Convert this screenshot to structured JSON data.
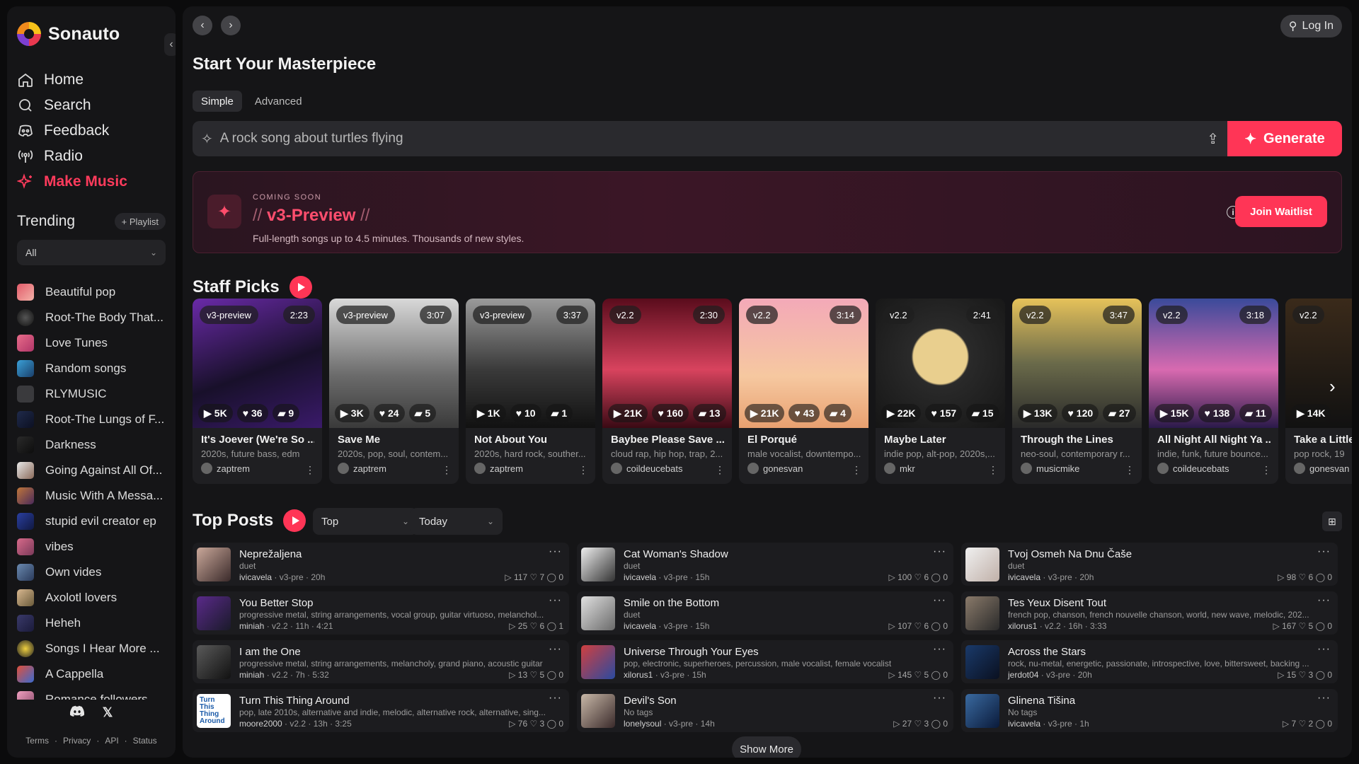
{
  "brand": {
    "name": "Sonauto"
  },
  "nav": [
    {
      "label": "Home",
      "icon": "home-icon"
    },
    {
      "label": "Search",
      "icon": "search-icon"
    },
    {
      "label": "Feedback",
      "icon": "discord-icon"
    },
    {
      "label": "Radio",
      "icon": "radio-icon"
    },
    {
      "label": "Make Music",
      "icon": "sparkle-icon",
      "active": true
    }
  ],
  "trending": {
    "title": "Trending",
    "playlist_button": "+ Playlist",
    "filter": "All",
    "items": [
      "Beautiful pop",
      "Root-The Body That...",
      "Love Tunes",
      "Random songs",
      "RLYMUSIC",
      "Root-The Lungs of F...",
      "Darkness",
      "Going Against All Of...",
      "Music With A Messa...",
      "stupid evil creator ep",
      "vibes",
      "Own vides",
      "Axolotl lovers",
      "Heheh",
      "Songs I Hear More ...",
      "A Cappella",
      "Romance followers"
    ]
  },
  "footer": {
    "links": [
      "Terms",
      "·",
      "Privacy",
      "·",
      "API",
      "·",
      "Status"
    ]
  },
  "header": {
    "login": "Log In"
  },
  "create": {
    "title": "Start Your Masterpiece",
    "tabs": [
      "Simple",
      "Advanced"
    ],
    "selected_tab": "Simple",
    "prompt_placeholder": "A rock song about turtles flying",
    "generate": "Generate"
  },
  "banner": {
    "eyebrow": "COMING SOON",
    "slash_left": "//",
    "title": "v3-Preview",
    "slash_right": "//",
    "description": "Full-length songs up to 4.5 minutes. Thousands of new styles.",
    "button": "Join Waitlist"
  },
  "staff_picks": {
    "title": "Staff Picks",
    "cards": [
      {
        "version": "v3-preview",
        "duration": "2:23",
        "plays": "5K",
        "likes": "36",
        "comments": "9",
        "title": "It's Joever (We're So ...",
        "tags": "2020s, future bass, edm",
        "user": "zaptrem"
      },
      {
        "version": "v3-preview",
        "duration": "3:07",
        "plays": "3K",
        "likes": "24",
        "comments": "5",
        "title": "Save Me",
        "tags": "2020s, pop, soul, contem...",
        "user": "zaptrem"
      },
      {
        "version": "v3-preview",
        "duration": "3:37",
        "plays": "1K",
        "likes": "10",
        "comments": "1",
        "title": "Not About You",
        "tags": "2020s, hard rock, souther...",
        "user": "zaptrem"
      },
      {
        "version": "v2.2",
        "duration": "2:30",
        "plays": "21K",
        "likes": "160",
        "comments": "13",
        "title": "Baybee Please Save ...",
        "tags": "cloud rap, hip hop, trap, 2...",
        "user": "coildeucebats"
      },
      {
        "version": "v2.2",
        "duration": "3:14",
        "plays": "21K",
        "likes": "43",
        "comments": "4",
        "title": "El Porqué",
        "tags": "male vocalist, downtempo...",
        "user": "gonesvan"
      },
      {
        "version": "v2.2",
        "duration": "2:41",
        "plays": "22K",
        "likes": "157",
        "comments": "15",
        "title": "Maybe Later",
        "tags": "indie pop, alt-pop, 2020s,...",
        "user": "mkr"
      },
      {
        "version": "v2.2",
        "duration": "3:47",
        "plays": "13K",
        "likes": "120",
        "comments": "27",
        "title": "Through the Lines",
        "tags": "neo-soul, contemporary r...",
        "user": "musicmike"
      },
      {
        "version": "v2.2",
        "duration": "3:18",
        "plays": "15K",
        "likes": "138",
        "comments": "11",
        "title": "All Night All Night Ya ...",
        "tags": "indie, funk, future bounce...",
        "user": "coildeucebats"
      },
      {
        "version": "v2.2",
        "duration": "",
        "plays": "14K",
        "likes": "",
        "comments": "",
        "title": "Take a Little",
        "tags": "pop rock, 19",
        "user": "gonesvan"
      }
    ]
  },
  "top_posts": {
    "title": "Top Posts",
    "sort": "Top",
    "range": "Today",
    "show_more": "Show More",
    "posts": [
      {
        "title": "Neprežaljena",
        "tags": "duet",
        "user": "ivicavela",
        "meta": " · v3-pre · 20h",
        "stats": "▷ 117  ♡ 7  ◯ 0"
      },
      {
        "title": "Cat Woman's Shadow",
        "tags": "duet",
        "user": "ivicavela",
        "meta": " · v3-pre · 15h",
        "stats": "▷ 100  ♡ 6  ◯ 0"
      },
      {
        "title": "Tvoj Osmeh Na Dnu Čaše",
        "tags": "duet",
        "user": "ivicavela",
        "meta": " · v3-pre · 20h",
        "stats": "▷ 98  ♡ 6  ◯ 0"
      },
      {
        "title": "You Better Stop",
        "tags": "progressive metal, string arrangements, vocal group, guitar virtuoso, melanchol...",
        "user": "miniah",
        "meta": " · v2.2 · 11h · 4:21",
        "stats": "▷ 25  ♡ 6  ◯ 1"
      },
      {
        "title": "Smile on the Bottom",
        "tags": "duet",
        "user": "ivicavela",
        "meta": " · v3-pre · 15h",
        "stats": "▷ 107  ♡ 6  ◯ 0"
      },
      {
        "title": "Tes Yeux Disent Tout",
        "tags": "french pop, chanson, french nouvelle chanson, world, new wave, melodic, 202...",
        "user": "xilorus1",
        "meta": " · v2.2 · 16h · 3:33",
        "stats": "▷ 167  ♡ 5  ◯ 0"
      },
      {
        "title": "I am the One",
        "tags": "progressive metal, string arrangements, melancholy, grand piano, acoustic guitar",
        "user": "miniah",
        "meta": " · v2.2 · 7h · 5:32",
        "stats": "▷ 13  ♡ 5  ◯ 0"
      },
      {
        "title": "Universe Through Your Eyes",
        "tags": "pop, electronic, superheroes, percussion, male vocalist, female vocalist",
        "user": "xilorus1",
        "meta": " · v3-pre · 15h",
        "stats": "▷ 145  ♡ 5  ◯ 0"
      },
      {
        "title": "Across the Stars",
        "tags": "rock, nu-metal, energetic, passionate, introspective, love, bittersweet, backing ...",
        "user": "jerdot04",
        "meta": " · v3-pre · 20h",
        "stats": "▷ 15  ♡ 3  ◯ 0"
      },
      {
        "title": "Turn This Thing Around",
        "tags": "pop, late 2010s, alternative and indie, melodic, alternative rock, alternative, sing...",
        "user": "moore2000",
        "meta": " · v2.2 · 13h · 3:25",
        "stats": "▷ 76  ♡ 3  ◯ 0",
        "art_text": "Turn This Thing Around"
      },
      {
        "title": "Devil's Son",
        "tags": "No tags",
        "user": "lonelysoul",
        "meta": " · v3-pre · 14h",
        "stats": "▷ 27  ♡ 3  ◯ 0"
      },
      {
        "title": "Glinena Tišina",
        "tags": "No tags",
        "user": "ivicavela",
        "meta": " · v3-pre · 1h",
        "stats": "▷ 7  ♡ 2  ◯ 0"
      }
    ]
  },
  "colors": {
    "accent": "#ff3556",
    "panel": "#151517",
    "background": "#0b0b0c"
  }
}
